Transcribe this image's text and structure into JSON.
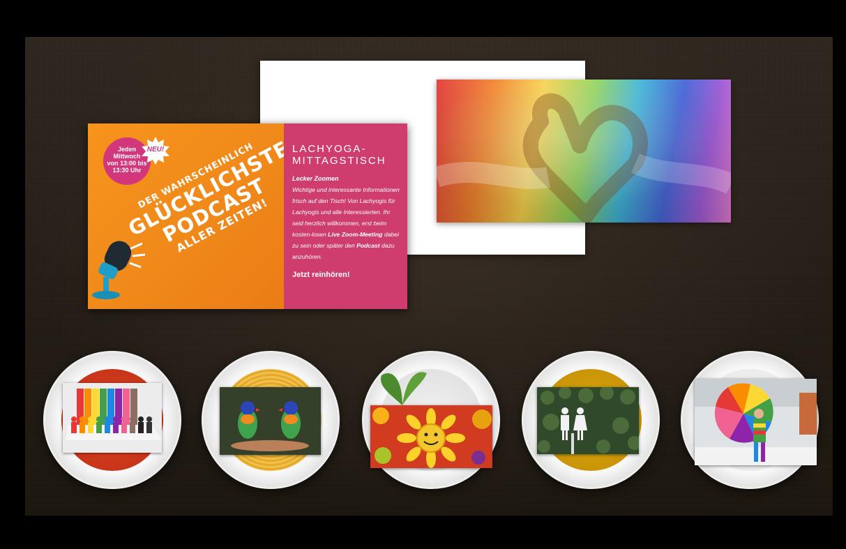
{
  "banner": {
    "badge": {
      "line1": "Jeden",
      "line2": "Mittwoch",
      "line3": "von 13:00 bis",
      "line4": "13:30 Uhr"
    },
    "neu": "NEU!",
    "headline": {
      "line1": "DER WAHRSCHEINLICH",
      "line2": "GLÜCKLICHSTE",
      "line3": "PODCAST",
      "line4": "ALLER ZEITEN!"
    },
    "right": {
      "title_line1": "LACHYOGA-",
      "title_line2": "MITTAGSTISCH",
      "subtitle": "Lecker Zoomen",
      "body_1": "Wichtige und interessante Informationen frisch auf den Tisch! Von Lachyogis für Lachyogis und alle Interessierten. Ihr seid herzlich willkommen, erst beim kosten-losen ",
      "body_live": "Live Zoom-Meeting",
      "body_2": " dabei zu sein oder später den ",
      "body_podcast": "Podcast",
      "body_3": " dazu anzuhören.",
      "link": "Jetzt reinhören!"
    }
  },
  "colors": {
    "orange": "#f7941d",
    "pink": "#cf3d6f",
    "badge": "#d2367b",
    "background": "#2a221a"
  },
  "plates": [
    {
      "name": "rainbow-figures-photo",
      "food": "tomato-soup"
    },
    {
      "name": "lorikeets-photo",
      "food": "pasta"
    },
    {
      "name": "smiling-sunflower-photo",
      "food": "salad"
    },
    {
      "name": "restroom-sign-photo",
      "food": "curry"
    },
    {
      "name": "rainbow-umbrella-person-photo",
      "food": "dessert"
    }
  ]
}
